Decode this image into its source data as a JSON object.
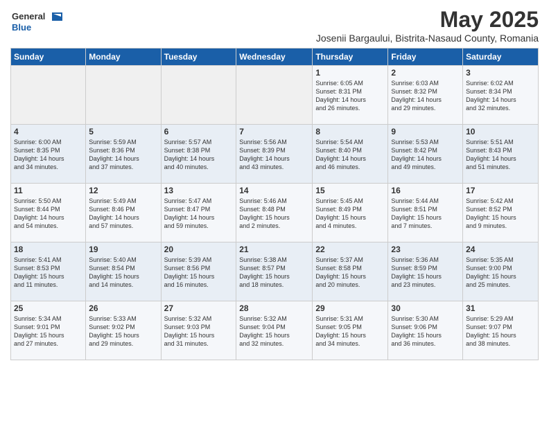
{
  "header": {
    "logo_general": "General",
    "logo_blue": "Blue",
    "main_title": "May 2025",
    "subtitle": "Josenii Bargaului, Bistrita-Nasaud County, Romania"
  },
  "calendar": {
    "headers": [
      "Sunday",
      "Monday",
      "Tuesday",
      "Wednesday",
      "Thursday",
      "Friday",
      "Saturday"
    ],
    "weeks": [
      {
        "days": [
          {
            "num": "",
            "info": "",
            "empty": true
          },
          {
            "num": "",
            "info": "",
            "empty": true
          },
          {
            "num": "",
            "info": "",
            "empty": true
          },
          {
            "num": "",
            "info": "",
            "empty": true
          },
          {
            "num": "1",
            "info": "Sunrise: 6:05 AM\nSunset: 8:31 PM\nDaylight: 14 hours\nand 26 minutes.",
            "empty": false
          },
          {
            "num": "2",
            "info": "Sunrise: 6:03 AM\nSunset: 8:32 PM\nDaylight: 14 hours\nand 29 minutes.",
            "empty": false
          },
          {
            "num": "3",
            "info": "Sunrise: 6:02 AM\nSunset: 8:34 PM\nDaylight: 14 hours\nand 32 minutes.",
            "empty": false
          }
        ]
      },
      {
        "days": [
          {
            "num": "4",
            "info": "Sunrise: 6:00 AM\nSunset: 8:35 PM\nDaylight: 14 hours\nand 34 minutes.",
            "empty": false
          },
          {
            "num": "5",
            "info": "Sunrise: 5:59 AM\nSunset: 8:36 PM\nDaylight: 14 hours\nand 37 minutes.",
            "empty": false
          },
          {
            "num": "6",
            "info": "Sunrise: 5:57 AM\nSunset: 8:38 PM\nDaylight: 14 hours\nand 40 minutes.",
            "empty": false
          },
          {
            "num": "7",
            "info": "Sunrise: 5:56 AM\nSunset: 8:39 PM\nDaylight: 14 hours\nand 43 minutes.",
            "empty": false
          },
          {
            "num": "8",
            "info": "Sunrise: 5:54 AM\nSunset: 8:40 PM\nDaylight: 14 hours\nand 46 minutes.",
            "empty": false
          },
          {
            "num": "9",
            "info": "Sunrise: 5:53 AM\nSunset: 8:42 PM\nDaylight: 14 hours\nand 49 minutes.",
            "empty": false
          },
          {
            "num": "10",
            "info": "Sunrise: 5:51 AM\nSunset: 8:43 PM\nDaylight: 14 hours\nand 51 minutes.",
            "empty": false
          }
        ]
      },
      {
        "days": [
          {
            "num": "11",
            "info": "Sunrise: 5:50 AM\nSunset: 8:44 PM\nDaylight: 14 hours\nand 54 minutes.",
            "empty": false
          },
          {
            "num": "12",
            "info": "Sunrise: 5:49 AM\nSunset: 8:46 PM\nDaylight: 14 hours\nand 57 minutes.",
            "empty": false
          },
          {
            "num": "13",
            "info": "Sunrise: 5:47 AM\nSunset: 8:47 PM\nDaylight: 14 hours\nand 59 minutes.",
            "empty": false
          },
          {
            "num": "14",
            "info": "Sunrise: 5:46 AM\nSunset: 8:48 PM\nDaylight: 15 hours\nand 2 minutes.",
            "empty": false
          },
          {
            "num": "15",
            "info": "Sunrise: 5:45 AM\nSunset: 8:49 PM\nDaylight: 15 hours\nand 4 minutes.",
            "empty": false
          },
          {
            "num": "16",
            "info": "Sunrise: 5:44 AM\nSunset: 8:51 PM\nDaylight: 15 hours\nand 7 minutes.",
            "empty": false
          },
          {
            "num": "17",
            "info": "Sunrise: 5:42 AM\nSunset: 8:52 PM\nDaylight: 15 hours\nand 9 minutes.",
            "empty": false
          }
        ]
      },
      {
        "days": [
          {
            "num": "18",
            "info": "Sunrise: 5:41 AM\nSunset: 8:53 PM\nDaylight: 15 hours\nand 11 minutes.",
            "empty": false
          },
          {
            "num": "19",
            "info": "Sunrise: 5:40 AM\nSunset: 8:54 PM\nDaylight: 15 hours\nand 14 minutes.",
            "empty": false
          },
          {
            "num": "20",
            "info": "Sunrise: 5:39 AM\nSunset: 8:56 PM\nDaylight: 15 hours\nand 16 minutes.",
            "empty": false
          },
          {
            "num": "21",
            "info": "Sunrise: 5:38 AM\nSunset: 8:57 PM\nDaylight: 15 hours\nand 18 minutes.",
            "empty": false
          },
          {
            "num": "22",
            "info": "Sunrise: 5:37 AM\nSunset: 8:58 PM\nDaylight: 15 hours\nand 20 minutes.",
            "empty": false
          },
          {
            "num": "23",
            "info": "Sunrise: 5:36 AM\nSunset: 8:59 PM\nDaylight: 15 hours\nand 23 minutes.",
            "empty": false
          },
          {
            "num": "24",
            "info": "Sunrise: 5:35 AM\nSunset: 9:00 PM\nDaylight: 15 hours\nand 25 minutes.",
            "empty": false
          }
        ]
      },
      {
        "days": [
          {
            "num": "25",
            "info": "Sunrise: 5:34 AM\nSunset: 9:01 PM\nDaylight: 15 hours\nand 27 minutes.",
            "empty": false
          },
          {
            "num": "26",
            "info": "Sunrise: 5:33 AM\nSunset: 9:02 PM\nDaylight: 15 hours\nand 29 minutes.",
            "empty": false
          },
          {
            "num": "27",
            "info": "Sunrise: 5:32 AM\nSunset: 9:03 PM\nDaylight: 15 hours\nand 31 minutes.",
            "empty": false
          },
          {
            "num": "28",
            "info": "Sunrise: 5:32 AM\nSunset: 9:04 PM\nDaylight: 15 hours\nand 32 minutes.",
            "empty": false
          },
          {
            "num": "29",
            "info": "Sunrise: 5:31 AM\nSunset: 9:05 PM\nDaylight: 15 hours\nand 34 minutes.",
            "empty": false
          },
          {
            "num": "30",
            "info": "Sunrise: 5:30 AM\nSunset: 9:06 PM\nDaylight: 15 hours\nand 36 minutes.",
            "empty": false
          },
          {
            "num": "31",
            "info": "Sunrise: 5:29 AM\nSunset: 9:07 PM\nDaylight: 15 hours\nand 38 minutes.",
            "empty": false
          }
        ]
      }
    ]
  }
}
